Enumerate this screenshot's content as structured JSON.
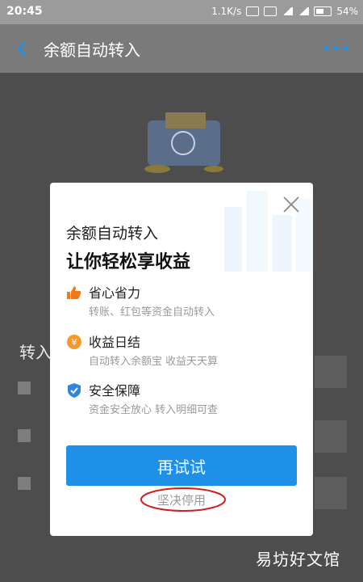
{
  "status_bar": {
    "time": "20:45",
    "speed": "1.1K/s",
    "battery": "54%"
  },
  "navbar": {
    "title": "余额自动转入",
    "back_icon": "chevron-left-icon",
    "more_icon": "more-dots-icon",
    "accent_color": "#1e90e8"
  },
  "background": {
    "section_label": "转入"
  },
  "modal": {
    "headline1": "余额自动转入",
    "headline2": "让你轻松享收益",
    "features": [
      {
        "icon": "thumbs-up-icon",
        "title": "省心省力",
        "desc": "转账、红包等资金自动转入"
      },
      {
        "icon": "yuan-coin-icon",
        "title": "收益日结",
        "desc": "自动转入余额宝 收益天天算"
      },
      {
        "icon": "shield-check-icon",
        "title": "安全保障",
        "desc": "资金安全放心 转入明细可查"
      }
    ],
    "primary_button": "再试试",
    "secondary_link": "坚决停用",
    "colors": {
      "primary": "#1e90e8",
      "thumbs_icon": "#f07a1a",
      "coin_icon": "#f39a2b",
      "shield_icon": "#2e86de",
      "annotation": "#d21e1e"
    }
  },
  "watermark": "易坊好文馆"
}
